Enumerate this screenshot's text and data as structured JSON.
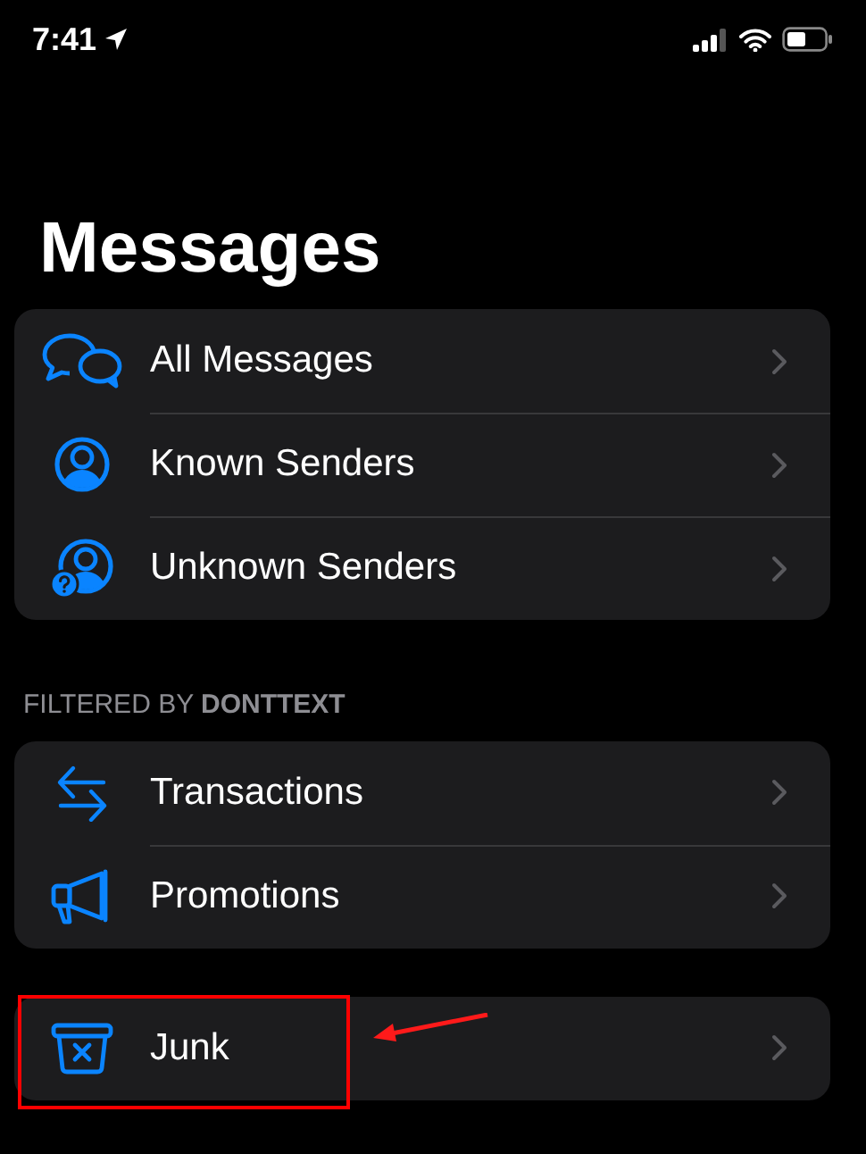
{
  "status_bar": {
    "time": "7:41"
  },
  "title": "Messages",
  "groups": [
    {
      "items": [
        {
          "label": "All Messages",
          "kind": "chats"
        },
        {
          "label": "Known Senders",
          "kind": "person"
        },
        {
          "label": "Unknown Senders",
          "kind": "person-question"
        }
      ]
    },
    {
      "header": "FILTERED BY **DONTTEXT**",
      "items": [
        {
          "label": "Transactions",
          "kind": "arrows"
        },
        {
          "label": "Promotions",
          "kind": "megaphone"
        }
      ]
    },
    {
      "items": [
        {
          "label": "Junk",
          "kind": "bin",
          "highlighted": true
        }
      ]
    }
  ]
}
